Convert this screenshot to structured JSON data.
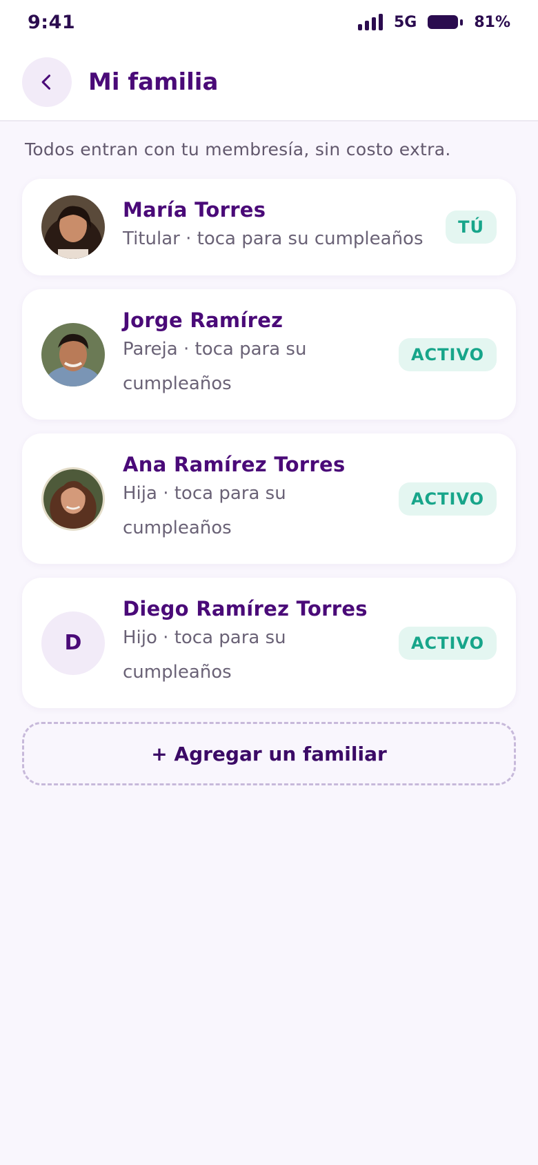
{
  "status_bar": {
    "time": "9:41",
    "network": "5G",
    "battery": "81%"
  },
  "header": {
    "title": "Mi familia"
  },
  "subtitle": "Todos entran con tu membresía, sin costo extra.",
  "members": [
    {
      "name": "María Torres",
      "desc": "Titular · toca para su cumpleaños",
      "badge": "TÚ"
    },
    {
      "name": "Jorge Ramírez",
      "desc": "Pareja · toca para su cumpleaños",
      "badge": "ACTIVO"
    },
    {
      "name": "Ana Ramírez Torres",
      "desc": "Hija · toca para su cumpleaños",
      "badge": "ACTIVO"
    },
    {
      "name": "Diego Ramírez Torres",
      "desc": "Hijo · toca para su cumpleaños",
      "badge": "ACTIVO",
      "initial": "D"
    }
  ],
  "add_button": {
    "label": "+ Agregar un familiar"
  },
  "colors": {
    "accent": "#4a0a78",
    "badge_text": "#17a58a",
    "badge_bg": "#e4f6f1",
    "background": "#f9f6fd"
  }
}
